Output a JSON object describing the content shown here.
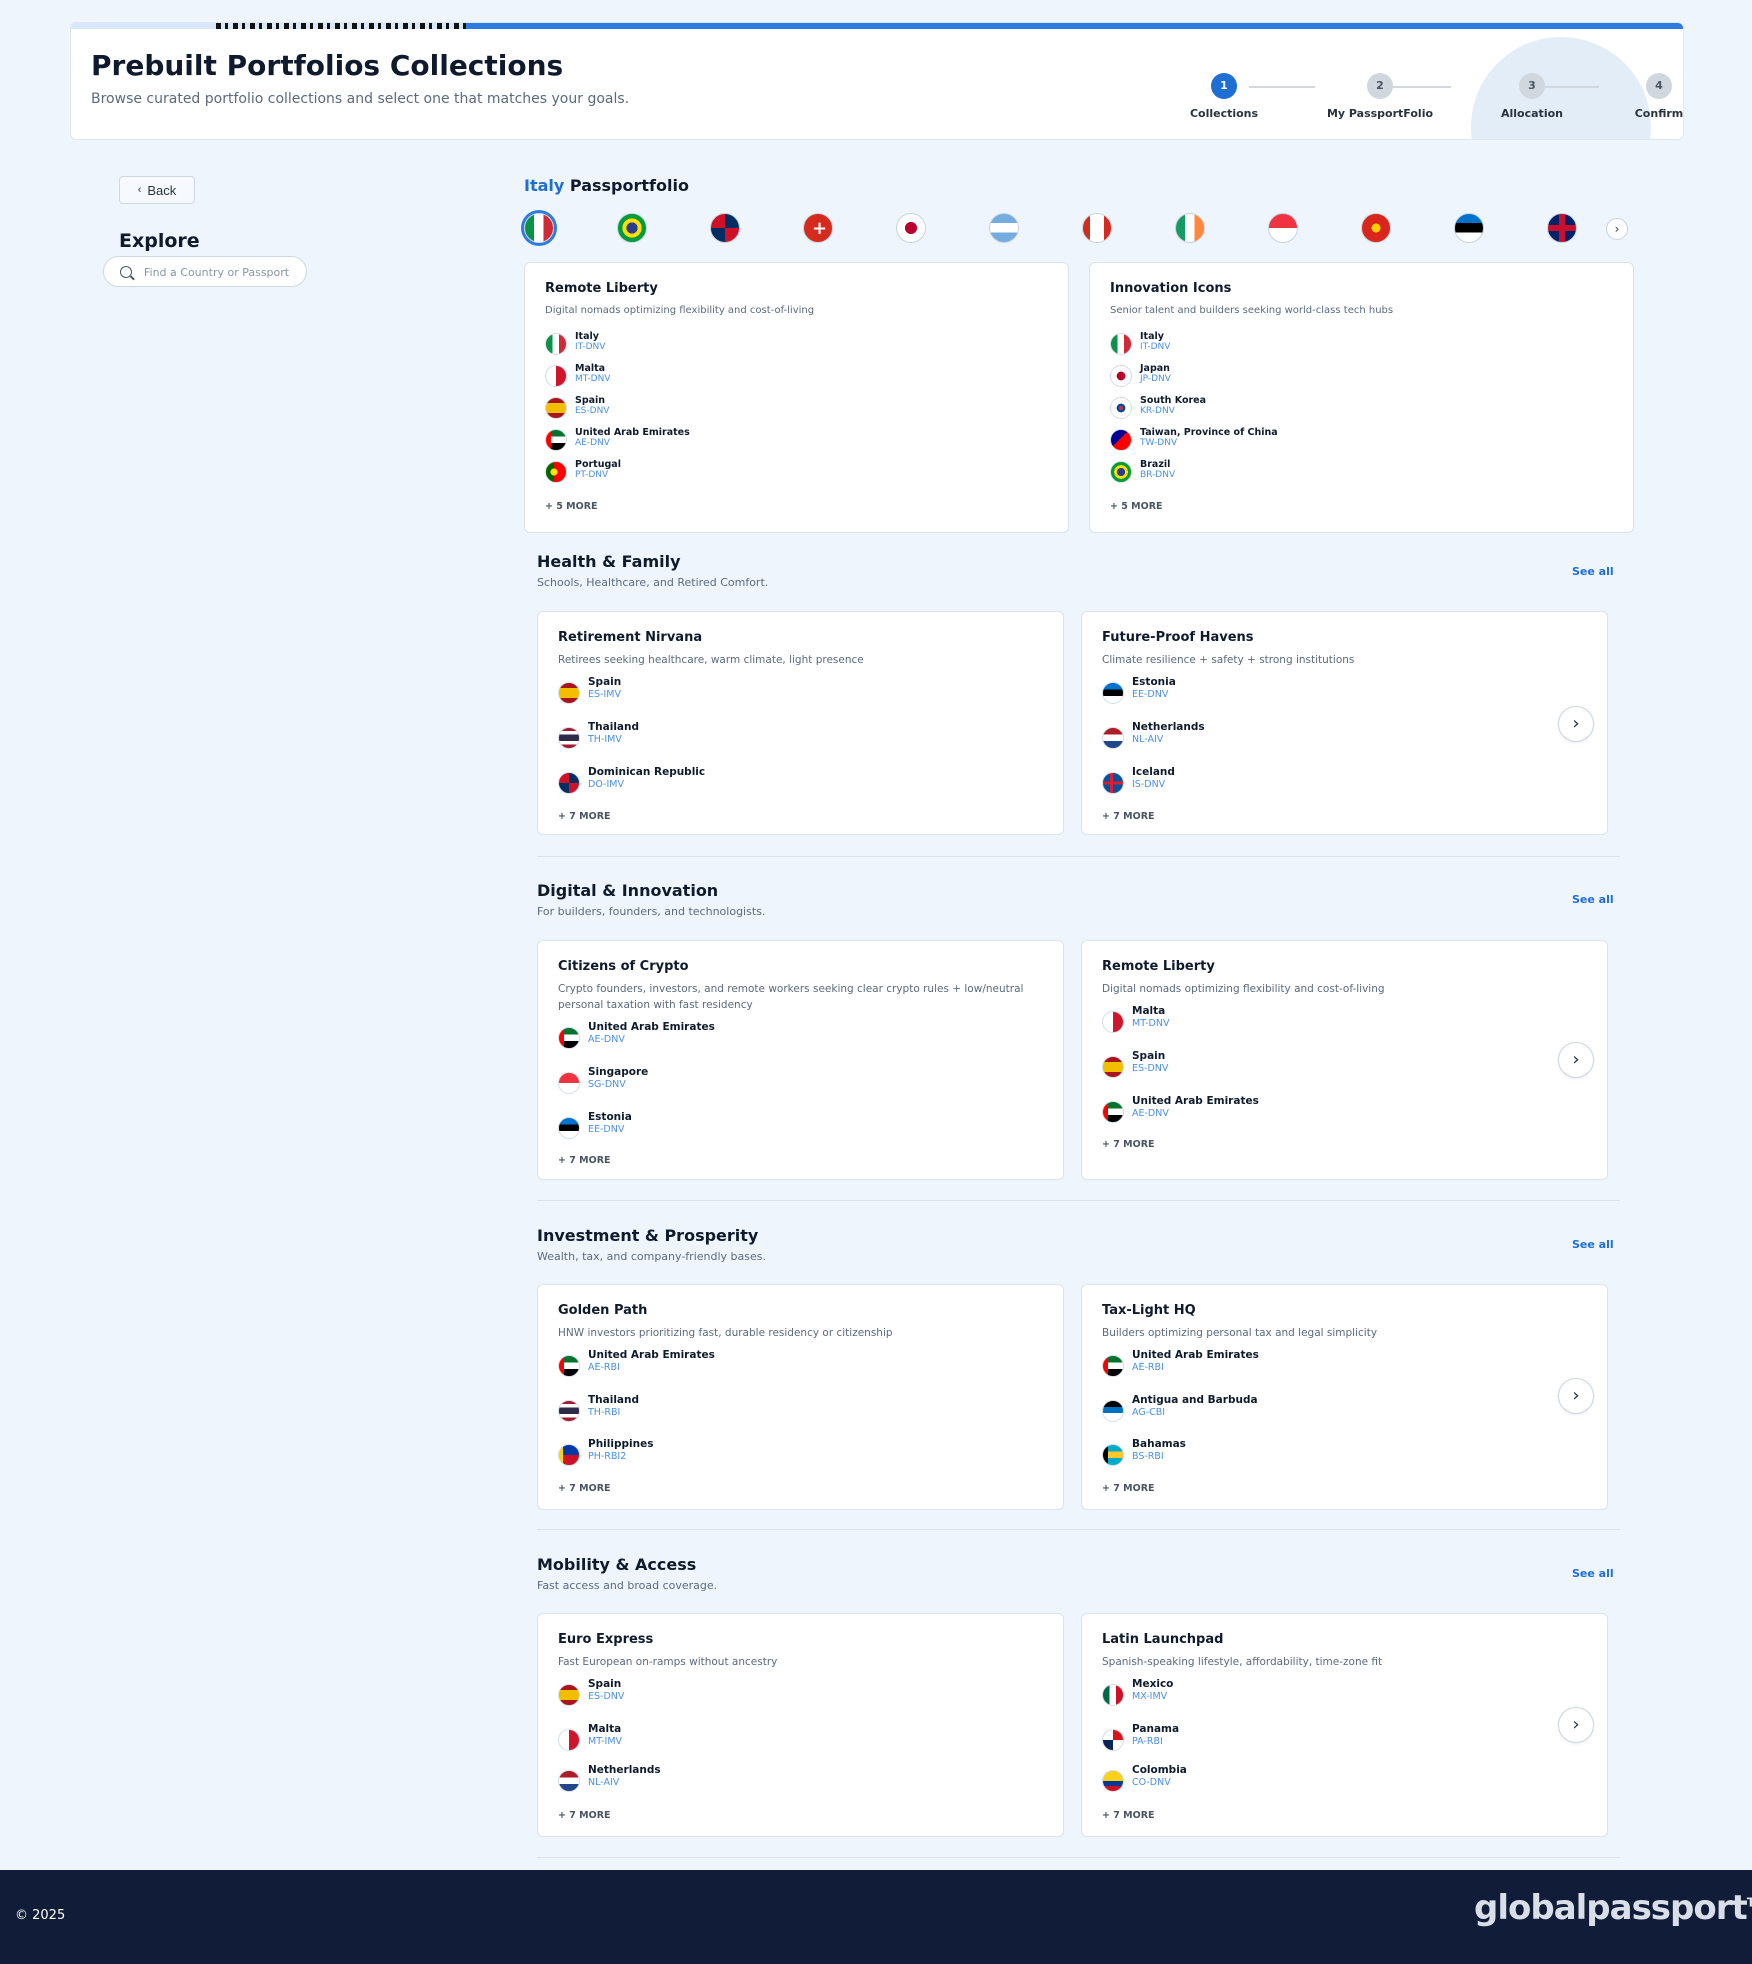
{
  "header": {
    "title": "Prebuilt Portfolios Collections",
    "subtitle": "Browse curated portfolio collections and select one that matches your goals.",
    "steps": [
      {
        "num": "1",
        "label": "Collections",
        "active": true
      },
      {
        "num": "2",
        "label": "My PassportFolio",
        "active": false
      },
      {
        "num": "3",
        "label": "Allocation",
        "active": false
      },
      {
        "num": "4",
        "label": "Confirm",
        "active": false
      }
    ]
  },
  "sidebar": {
    "back_label": "Back",
    "explore_title": "Explore",
    "search_placeholder": "Find a Country or Passport"
  },
  "passportfolio": {
    "country": "Italy",
    "title": "Passportfolio",
    "flags": [
      "italy-flag-icon",
      "brazil-flag-icon",
      "dominican-republic-flag-icon",
      "switzerland-flag-icon",
      "japan-flag-icon",
      "argentina-flag-icon",
      "canada-flag-icon",
      "ireland-flag-icon",
      "singapore-flag-icon",
      "vietnam-flag-icon",
      "estonia-flag-icon",
      "united-kingdom-flag-icon"
    ],
    "cards": [
      {
        "title": "Remote Liberty",
        "desc": "Digital nomads optimizing flexibility and cost-of-living",
        "countries": [
          {
            "name": "Italy",
            "code": "IT-DNV",
            "flag": "italy"
          },
          {
            "name": "Malta",
            "code": "MT-DNV",
            "flag": "malta"
          },
          {
            "name": "Spain",
            "code": "ES-DNV",
            "flag": "spain"
          },
          {
            "name": "United Arab Emirates",
            "code": "AE-DNV",
            "flag": "uae"
          },
          {
            "name": "Portugal",
            "code": "PT-DNV",
            "flag": "portugal"
          }
        ],
        "more": "+ 5 MORE"
      },
      {
        "title": "Innovation Icons",
        "desc": "Senior talent and builders seeking world-class tech hubs",
        "countries": [
          {
            "name": "Italy",
            "code": "IT-DNV",
            "flag": "italy"
          },
          {
            "name": "Japan",
            "code": "JP-DNV",
            "flag": "japan"
          },
          {
            "name": "South Korea",
            "code": "KR-DNV",
            "flag": "korea"
          },
          {
            "name": "Taiwan, Province of China",
            "code": "TW-DNV",
            "flag": "taiwan"
          },
          {
            "name": "Brazil",
            "code": "BR-DNV",
            "flag": "brazil"
          }
        ],
        "more": "+ 5 MORE"
      }
    ]
  },
  "sections": [
    {
      "title": "Health & Family",
      "subtitle": "Schools, Healthcare, and Retired Comfort.",
      "see_all": "See all",
      "cards": [
        {
          "title": "Retirement Nirvana",
          "desc": "Retirees seeking healthcare, warm climate, light presence",
          "countries": [
            {
              "name": "Spain",
              "code": "ES-IMV",
              "flag": "spain"
            },
            {
              "name": "Thailand",
              "code": "TH-IMV",
              "flag": "thailand"
            },
            {
              "name": "Dominican Republic",
              "code": "DO-IMV",
              "flag": "dominican"
            }
          ],
          "more": "+ 7 MORE"
        },
        {
          "title": "Future-Proof Havens",
          "desc": "Climate resilience + safety + strong institutions",
          "countries": [
            {
              "name": "Estonia",
              "code": "EE-DNV",
              "flag": "estonia"
            },
            {
              "name": "Netherlands",
              "code": "NL-AIV",
              "flag": "netherlands"
            },
            {
              "name": "Iceland",
              "code": "IS-DNV",
              "flag": "iceland"
            }
          ],
          "more": "+ 7 MORE"
        }
      ]
    },
    {
      "title": "Digital & Innovation",
      "subtitle": "For builders, founders, and technologists.",
      "see_all": "See all",
      "cards": [
        {
          "title": "Citizens of Crypto",
          "desc": "Crypto founders, investors, and remote workers seeking clear crypto rules + low/neutral personal taxation with fast residency",
          "countries": [
            {
              "name": "United Arab Emirates",
              "code": "AE-DNV",
              "flag": "uae"
            },
            {
              "name": "Singapore",
              "code": "SG-DNV",
              "flag": "singapore"
            },
            {
              "name": "Estonia",
              "code": "EE-DNV",
              "flag": "estonia"
            }
          ],
          "more": "+ 7 MORE"
        },
        {
          "title": "Remote Liberty",
          "desc": "Digital nomads optimizing flexibility and cost-of-living",
          "countries": [
            {
              "name": "Malta",
              "code": "MT-DNV",
              "flag": "malta"
            },
            {
              "name": "Spain",
              "code": "ES-DNV",
              "flag": "spain"
            },
            {
              "name": "United Arab Emirates",
              "code": "AE-DNV",
              "flag": "uae"
            }
          ],
          "more": "+ 7 MORE"
        }
      ]
    },
    {
      "title": "Investment & Prosperity",
      "subtitle": "Wealth, tax, and company-friendly bases.",
      "see_all": "See all",
      "cards": [
        {
          "title": "Golden Path",
          "desc": "HNW investors prioritizing fast, durable residency or citizenship",
          "countries": [
            {
              "name": "United Arab Emirates",
              "code": "AE-RBI",
              "flag": "uae"
            },
            {
              "name": "Thailand",
              "code": "TH-RBI",
              "flag": "thailand"
            },
            {
              "name": "Philippines",
              "code": "PH-RBI2",
              "flag": "philippines"
            }
          ],
          "more": "+ 7 MORE"
        },
        {
          "title": "Tax-Light HQ",
          "desc": "Builders optimizing personal tax and legal simplicity",
          "countries": [
            {
              "name": "United Arab Emirates",
              "code": "AE-RBI",
              "flag": "uae"
            },
            {
              "name": "Antigua and Barbuda",
              "code": "AG-CBI",
              "flag": "antigua"
            },
            {
              "name": "Bahamas",
              "code": "BS-RBI",
              "flag": "bahamas"
            }
          ],
          "more": "+ 7 MORE"
        }
      ]
    },
    {
      "title": "Mobility & Access",
      "subtitle": "Fast access and broad coverage.",
      "see_all": "See all",
      "cards": [
        {
          "title": "Euro Express",
          "desc": "Fast European on-ramps without ancestry",
          "countries": [
            {
              "name": "Spain",
              "code": "ES-DNV",
              "flag": "spain"
            },
            {
              "name": "Malta",
              "code": "MT-IMV",
              "flag": "malta"
            },
            {
              "name": "Netherlands",
              "code": "NL-AIV",
              "flag": "netherlands"
            }
          ],
          "more": "+ 7 MORE"
        },
        {
          "title": "Latin Launchpad",
          "desc": "Spanish-speaking lifestyle, affordability, time-zone fit",
          "countries": [
            {
              "name": "Mexico",
              "code": "MX-IMV",
              "flag": "mexico"
            },
            {
              "name": "Panama",
              "code": "PA-RBI",
              "flag": "panama"
            },
            {
              "name": "Colombia",
              "code": "CO-DNV",
              "flag": "colombia"
            }
          ],
          "more": "+ 7 MORE"
        }
      ]
    }
  ],
  "footer": {
    "copyright": "© 2025",
    "logo": "globalpassport",
    "logo_tm": "TM"
  },
  "colors": {
    "accent": "#1f6ed4",
    "code": "#4a90e2",
    "footer": "#101c38",
    "background": "#eef5fd"
  }
}
